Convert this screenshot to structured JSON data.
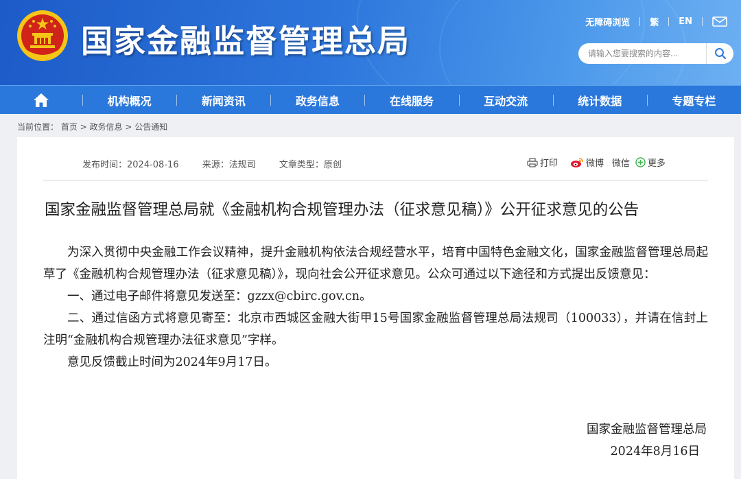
{
  "header": {
    "site_title": "国家金融监督管理总局",
    "accessibility": "无障碍浏览",
    "traditional": "繁",
    "english": "EN",
    "search_placeholder": "请输入您要搜索的内容..."
  },
  "nav": {
    "items": [
      "机构概况",
      "新闻资讯",
      "政务信息",
      "在线服务",
      "互动交流",
      "统计数据",
      "专题专栏"
    ]
  },
  "breadcrumb": {
    "label": "当前位置：",
    "items": [
      "首页",
      "政务信息",
      "公告通知"
    ],
    "sep": " > "
  },
  "article": {
    "meta": {
      "date": "发布时间：2024-08-16",
      "source": "来源：法规司",
      "type": "文章类型：原创"
    },
    "share": {
      "print": "打印",
      "weibo": "微博",
      "wechat": "微信",
      "more": "更多"
    },
    "title": "国家金融监督管理总局就《金融机构合规管理办法（征求意见稿）》公开征求意见的公告",
    "paragraphs": [
      "为深入贯彻中央金融工作会议精神，提升金融机构依法合规经营水平，培育中国特色金融文化，国家金融监督管理总局起草了《金融机构合规管理办法（征求意见稿）》，现向社会公开征求意见。公众可通过以下途径和方式提出反馈意见：",
      "一、通过电子邮件将意见发送至：gzzx@cbirc.gov.cn。",
      "二、通过信函方式将意见寄至：北京市西城区金融大街甲15号国家金融监督管理总局法规司（100033），并请在信封上注明“金融机构合规管理办法征求意见”字样。",
      "意见反馈截止时间为2024年9月17日。"
    ],
    "signature": "国家金融监督管理总局",
    "sign_date": "2024年8月16日"
  },
  "colors": {
    "header_blue": "#2d76dc",
    "nav_blue": "#2b78dc",
    "emblem_red": "#d0241b",
    "emblem_gold": "#f5c518"
  }
}
